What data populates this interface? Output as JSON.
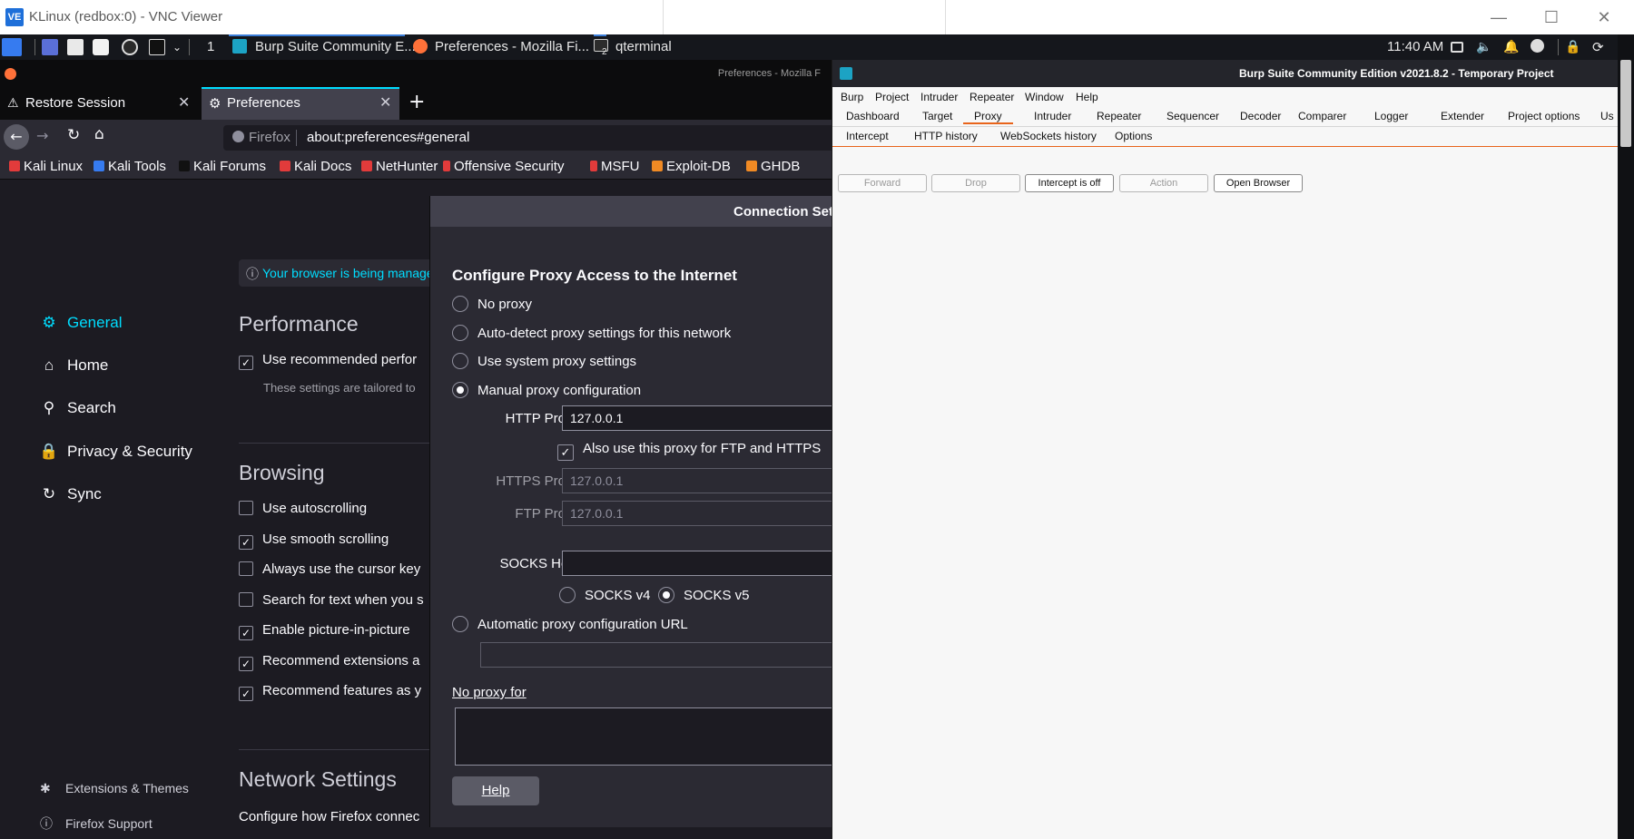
{
  "vnc": {
    "title": "KLinux (redbox:0) - VNC Viewer",
    "logo": "VE"
  },
  "taskbar": {
    "workspace": "1",
    "windows": [
      {
        "label": "Burp Suite Community E..."
      },
      {
        "label": "Preferences - Mozilla Fi..."
      },
      {
        "label": "qterminal"
      }
    ],
    "terminal_badge": "2",
    "clock": "11:40 AM"
  },
  "firefox": {
    "window_title": "Preferences - Mozilla F",
    "tabs": [
      {
        "label": "Restore Session"
      },
      {
        "label": "Preferences"
      }
    ],
    "url_identity": "Firefox",
    "url": "about:preferences#general",
    "bookmarks": [
      "Kali Linux",
      "Kali Tools",
      "Kali Forums",
      "Kali Docs",
      "NetHunter",
      "Offensive Security",
      "MSFU",
      "Exploit-DB",
      "GHDB"
    ],
    "managed_notice": "Your browser is being manage",
    "sidebar": {
      "items": [
        "General",
        "Home",
        "Search",
        "Privacy & Security",
        "Sync"
      ],
      "footer": [
        "Extensions & Themes",
        "Firefox Support"
      ]
    },
    "performance": {
      "heading": "Performance",
      "use_recommended": "Use recommended perfor",
      "tailored": "These settings are tailored to"
    },
    "browsing": {
      "heading": "Browsing",
      "options": [
        {
          "label": "Use autoscrolling",
          "checked": false
        },
        {
          "label": "Use smooth scrolling",
          "checked": true
        },
        {
          "label": "Always use the cursor key",
          "checked": false
        },
        {
          "label": "Search for text when you s",
          "checked": false
        },
        {
          "label": "Enable picture-in-picture",
          "checked": true
        },
        {
          "label": "Recommend extensions a",
          "checked": true
        },
        {
          "label": "Recommend features as y",
          "checked": true
        }
      ]
    },
    "network": {
      "heading": "Network Settings",
      "desc": "Configure how Firefox connec"
    }
  },
  "dialog": {
    "title": "Connection Sett",
    "heading": "Configure Proxy Access to the Internet",
    "options": {
      "no_proxy": "No proxy",
      "auto_detect": "Auto-detect proxy settings for this network",
      "system": "Use system proxy settings",
      "manual": "Manual proxy configuration",
      "pac": "Automatic proxy configuration URL"
    },
    "selected": "manual",
    "http_proxy_label": "HTTP Proxy",
    "http_proxy_value": "127.0.0.1",
    "also_use": "Also use this proxy for FTP and HTTPS",
    "also_use_checked": true,
    "https_proxy_label": "HTTPS Proxy",
    "https_proxy_value": "127.0.0.1",
    "ftp_proxy_label": "FTP Proxy",
    "ftp_proxy_value": "127.0.0.1",
    "socks_host_label": "SOCKS Host",
    "socks_v4": "SOCKS v4",
    "socks_v5": "SOCKS v5",
    "socks_selected": "v5",
    "no_proxy_for": "No proxy for",
    "help": "Help"
  },
  "burp": {
    "title": "Burp Suite Community Edition v2021.8.2 - Temporary Project",
    "menu": [
      "Burp",
      "Project",
      "Intruder",
      "Repeater",
      "Window",
      "Help"
    ],
    "tabs": [
      "Dashboard",
      "Target",
      "Proxy",
      "Intruder",
      "Repeater",
      "Sequencer",
      "Decoder",
      "Comparer",
      "Logger",
      "Extender",
      "Project options",
      "Us"
    ],
    "active_tab": "Proxy",
    "subtabs": [
      "Intercept",
      "HTTP history",
      "WebSockets history",
      "Options"
    ],
    "active_subtab": "Intercept",
    "buttons": {
      "forward": "Forward",
      "drop": "Drop",
      "intercept": "Intercept is off",
      "action": "Action",
      "open_browser": "Open Browser"
    }
  },
  "colors": {
    "burp_accent": "#e8641b",
    "firefox_accent": "#00ddff",
    "taskbar_bg": "#15171c"
  }
}
